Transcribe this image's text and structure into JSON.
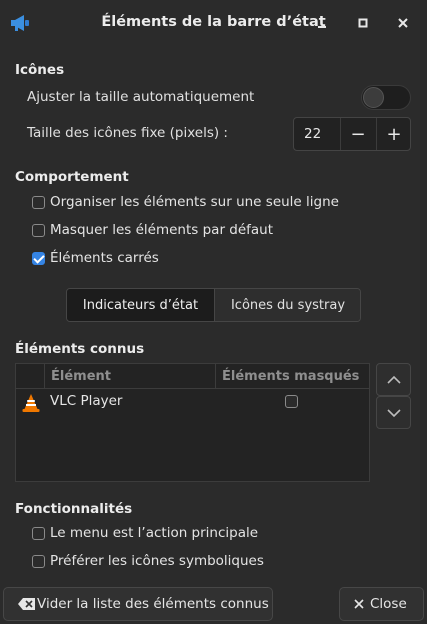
{
  "window": {
    "title": "Éléments de la barre d’état",
    "icon": "megaphone-icon",
    "controls": [
      "minimize-icon",
      "maximize-icon",
      "close-icon"
    ]
  },
  "icons_section": {
    "heading": "Icônes",
    "auto_size_label": "Ajuster la taille automatiquement",
    "auto_size_enabled": false,
    "fixed_size_label": "Taille des icônes fixe (pixels) :",
    "fixed_size_value": "22",
    "minus": "−",
    "plus": "+"
  },
  "behavior_section": {
    "heading": "Comportement",
    "options": [
      {
        "label": "Organiser les éléments sur une seule ligne",
        "checked": false
      },
      {
        "label": "Masquer les éléments par défaut",
        "checked": false
      },
      {
        "label": "Éléments carrés",
        "checked": true
      }
    ]
  },
  "tabs": [
    {
      "label": "Indicateurs d’état",
      "active": true
    },
    {
      "label": "Icônes du systray",
      "active": false
    }
  ],
  "known_section": {
    "heading": "Éléments connus",
    "columns": [
      "Élément",
      "Éléments masqués"
    ],
    "rows": [
      {
        "icon": "vlc-icon",
        "name": "VLC Player",
        "hidden": false
      }
    ]
  },
  "features_section": {
    "heading": "Fonctionnalités",
    "options": [
      {
        "label": "Le menu est l’action principale",
        "checked": false
      },
      {
        "label": "Préférer les icônes symboliques",
        "checked": false
      }
    ]
  },
  "footer": {
    "clear_label": "Vider la liste des éléments connus",
    "close_label": "Close"
  },
  "colors": {
    "background": "#2b2b2b",
    "accent": "#3584e4"
  }
}
